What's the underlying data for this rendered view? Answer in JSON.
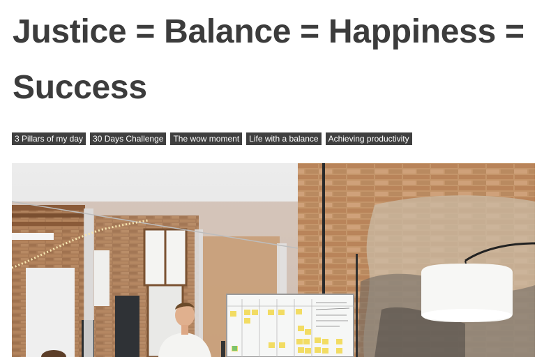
{
  "post": {
    "title": "Justice = Balance = Happiness = Success",
    "tags": [
      "3 Pillars of my day",
      "30 Days Challenge",
      "The wow moment",
      "Life with a balance",
      "Achieving productivity"
    ]
  },
  "image": {
    "description_icon": "office-photo",
    "colors": {
      "tag_bg": "#3f3f3f",
      "title": "#3c3c3c"
    }
  }
}
